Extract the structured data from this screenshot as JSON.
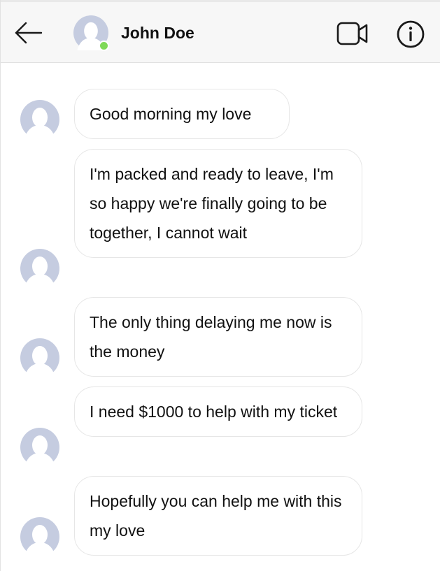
{
  "header": {
    "contact_name": "John Doe",
    "online_status_color": "#7ed957",
    "back_icon": "arrow-left-icon",
    "video_icon": "video-camera-icon",
    "info_icon": "info-icon"
  },
  "messages": [
    {
      "text": "Good morning my love"
    },
    {
      "text": "I'm packed and ready to leave, I'm so happy we're finally going to be together, I cannot wait"
    },
    {
      "text": "The only thing delaying me now is the money"
    },
    {
      "text": "I need $1000 to help with my ticket"
    },
    {
      "text": "Hopefully you can help me with this my love"
    }
  ],
  "colors": {
    "avatar": "#c5cce0",
    "header_bg": "#f7f7f7",
    "bubble_border": "#e6e6e6"
  }
}
